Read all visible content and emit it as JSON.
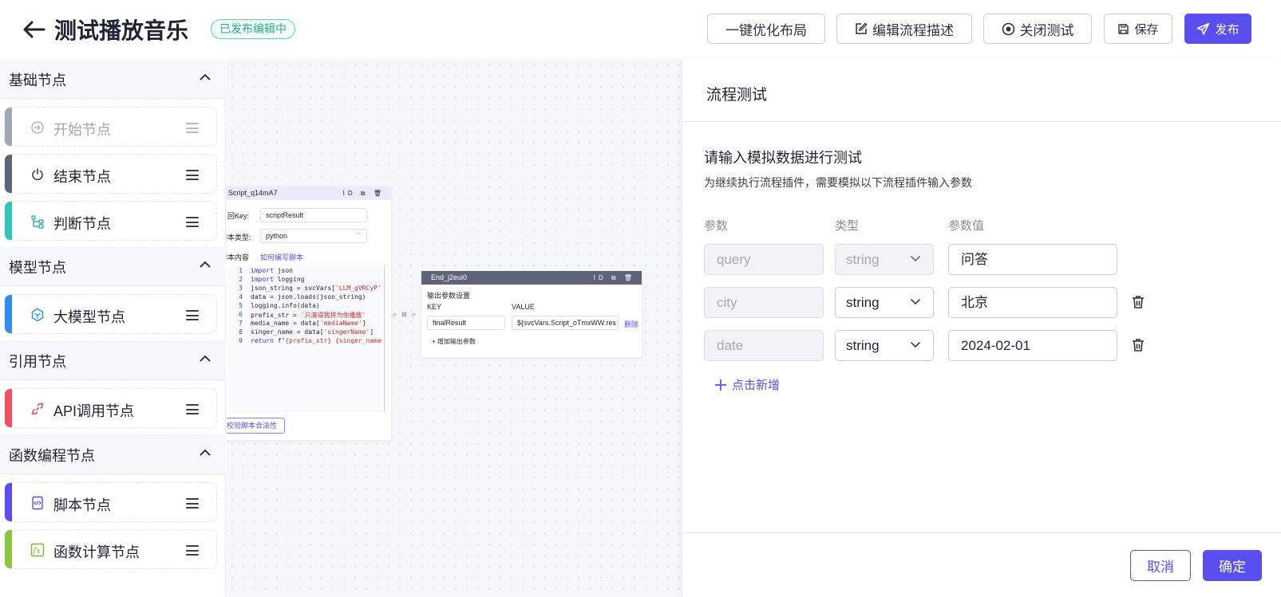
{
  "header": {
    "title": "测试播放音乐",
    "badge": "已发布编辑中",
    "buttons": {
      "optimize": "一键优化布局",
      "edit_desc": "编辑流程描述",
      "close_test": "关闭测试",
      "save": "保存",
      "publish": "发布"
    }
  },
  "sidebar": {
    "sections": [
      {
        "title": "基础节点",
        "items": [
          {
            "label": "开始节点",
            "icon": "login-arrow-icon",
            "color": "#a3a6b3",
            "disabled": true
          },
          {
            "label": "结束节点",
            "icon": "power-icon",
            "color": "#5e6379"
          },
          {
            "label": "判断节点",
            "icon": "branch-icon",
            "color": "#2fc7b8"
          }
        ]
      },
      {
        "title": "模型节点",
        "items": [
          {
            "label": "大模型节点",
            "icon": "cube-icon",
            "color": "#2f8cf0"
          }
        ]
      },
      {
        "title": "引用节点",
        "items": [
          {
            "label": "API调用节点",
            "icon": "link-icon",
            "color": "#f0515f"
          }
        ]
      },
      {
        "title": "函数编程节点",
        "items": [
          {
            "label": "脚本节点",
            "icon": "code-file-icon",
            "color": "#5b4ef0"
          },
          {
            "label": "函数计算节点",
            "icon": "fx-icon",
            "color": "#8cc63f"
          }
        ]
      }
    ]
  },
  "canvas": {
    "script_node": {
      "title": "Script_q14mA7",
      "actions": "ID",
      "return_key_label": "返回Key:",
      "return_key_value": "scriptResult",
      "script_type_label": "脚本类型:",
      "script_type_value": "python",
      "content_label": "脚本内容",
      "help_link": "如何编写脚本",
      "code_lines": [
        "import json",
        "import logging",
        "json_string = svcVars['LLM_gVRCyP'",
        "data = json.loads(json_string)",
        "logging.info(data)",
        "prefix_str = '只演得我将为你播放'",
        "media_name = data['mediaName']",
        "singer_name = data['singerName']",
        "return f\"{prefix_str} {singer_name"
      ],
      "validate_btn": "校验脚本合法性"
    },
    "end_node": {
      "title": "End_j2eui0",
      "actions": "ID",
      "section_label": "输出参数设置",
      "key_header": "KEY",
      "value_header": "VALUE",
      "key_value": "finalResult",
      "value_value": "${svcVars.Script_oTmxWW.res",
      "delete_link": "删除",
      "add_param": "+ 增加输出参数"
    }
  },
  "panel": {
    "title": "流程测试",
    "heading": "请输入模拟数据进行测试",
    "description": "为继续执行流程插件，需要模拟以下流程插件输入参数",
    "columns": {
      "name": "参数",
      "type": "类型",
      "value": "参数值"
    },
    "params": [
      {
        "name": "query",
        "type": "string",
        "value": "问答",
        "locked": true
      },
      {
        "name": "city",
        "type": "string",
        "value": "北京",
        "locked": false
      },
      {
        "name": "date",
        "type": "string",
        "value": "2024-02-01",
        "locked": false
      }
    ],
    "add_new": "点击新增",
    "cancel": "取消",
    "confirm": "确定"
  },
  "colors": {
    "accent": "#5b4ef0",
    "badge": "#27b08e"
  }
}
